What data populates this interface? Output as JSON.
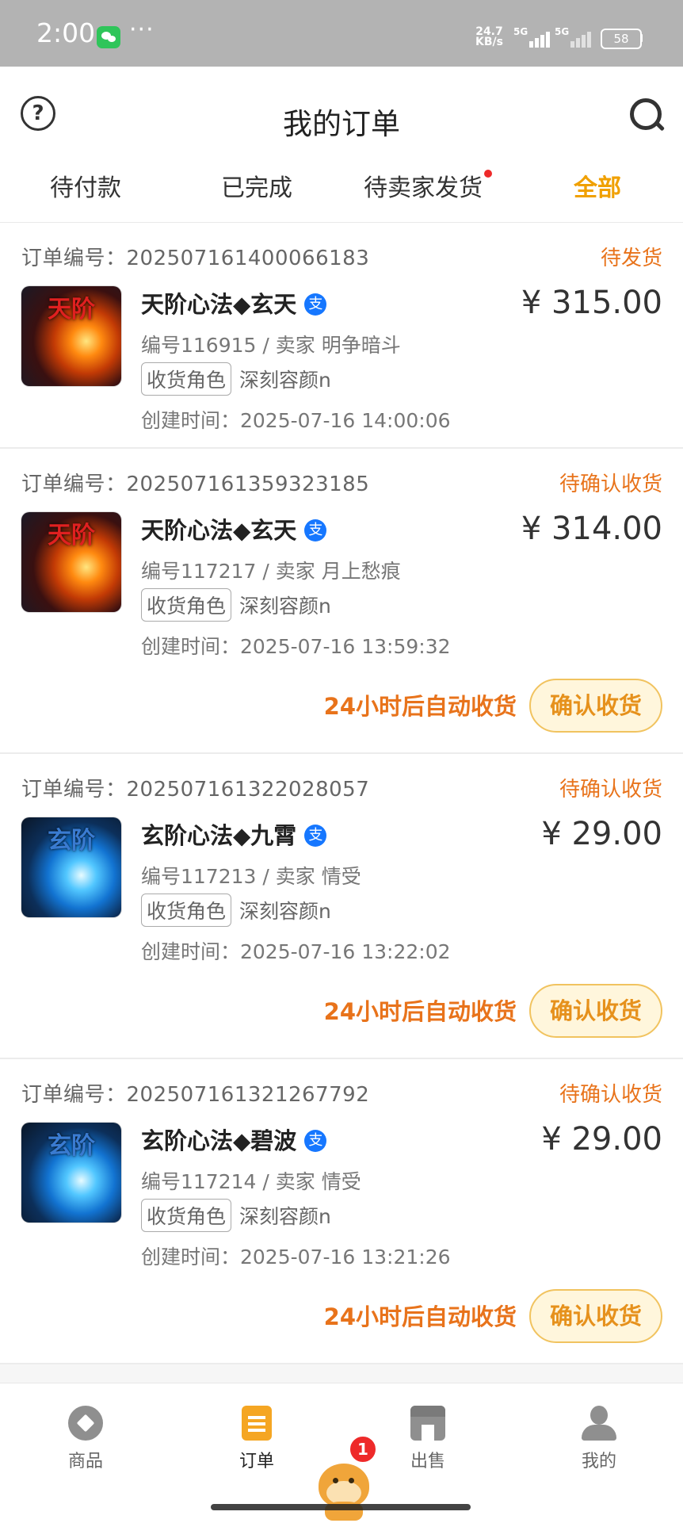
{
  "status_bar": {
    "time": "2:00",
    "dots": "···",
    "net_speed_value": "24.7",
    "net_speed_unit": "KB/s",
    "sim1": "5G",
    "sim2": "5G",
    "battery": "58"
  },
  "header": {
    "title": "我的订单",
    "tabs": [
      {
        "label": "待付款"
      },
      {
        "label": "已完成"
      },
      {
        "label": "待卖家发货",
        "has_dot": true
      },
      {
        "label": "全部",
        "active": true
      }
    ]
  },
  "orders": [
    {
      "order_no": "订单编号：202507161400066183",
      "status": "待发货",
      "thumb_label": "天阶",
      "title": "天阶心法◆玄天",
      "pay_icon": "支",
      "price": "¥ 315.00",
      "meta": "编号116915 / 卖家 明争暗斗",
      "role_tag": "收货角色",
      "role_name": "深刻容颜n",
      "created": "创建时间：2025-07-16 14:00:06"
    },
    {
      "order_no": "订单编号：202507161359323185",
      "status": "待确认收货",
      "thumb_label": "天阶",
      "title": "天阶心法◆玄天",
      "pay_icon": "支",
      "price": "¥ 314.00",
      "meta": "编号117217 / 卖家 月上愁痕",
      "role_tag": "收货角色",
      "role_name": "深刻容颜n",
      "created": "创建时间：2025-07-16 13:59:32",
      "auto_text": "24小时后自动收货",
      "button": "确认收货"
    },
    {
      "order_no": "订单编号：202507161322028057",
      "status": "待确认收货",
      "thumb_label": "玄阶",
      "title": "玄阶心法◆九霄",
      "pay_icon": "支",
      "price": "¥ 29.00",
      "meta": "编号117213 / 卖家 情受",
      "role_tag": "收货角色",
      "role_name": "深刻容颜n",
      "created": "创建时间：2025-07-16 13:22:02",
      "auto_text": "24小时后自动收货",
      "button": "确认收货"
    },
    {
      "order_no": "订单编号：202507161321267792",
      "status": "待确认收货",
      "thumb_label": "玄阶",
      "title": "玄阶心法◆碧波",
      "pay_icon": "支",
      "price": "¥ 29.00",
      "meta": "编号117214 / 卖家 情受",
      "role_tag": "收货角色",
      "role_name": "深刻容颜n",
      "created": "创建时间：2025-07-16 13:21:26",
      "auto_text": "24小时后自动收货",
      "button": "确认收货"
    }
  ],
  "nav": {
    "items": [
      {
        "label": "商品",
        "icon": "diamond-icon"
      },
      {
        "label": "订单",
        "icon": "clipboard-icon",
        "active": true
      },
      {
        "label": "出售",
        "icon": "store-icon"
      },
      {
        "label": "我的",
        "icon": "person-icon"
      }
    ],
    "badge": "1"
  },
  "colors": {
    "accent": "#f0a000",
    "status_orange": "#e8731b",
    "button_bg": "#fff6dc",
    "button_border": "#f1c35f",
    "alipay_blue": "#1677ff",
    "red_dot": "#ee2a2a"
  }
}
